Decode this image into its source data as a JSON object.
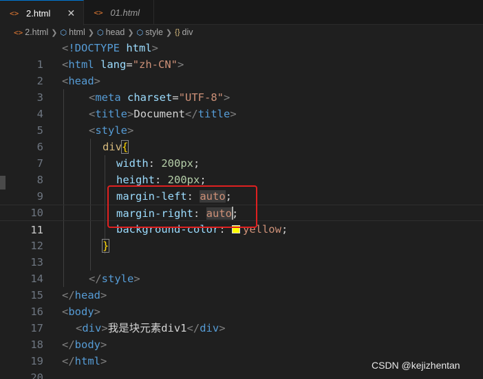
{
  "tabs": [
    {
      "label": "2.html",
      "icon": "html-file-icon",
      "active": true,
      "close": "✕"
    },
    {
      "label": "01.html",
      "icon": "html-file-icon",
      "active": false
    }
  ],
  "breadcrumb": [
    "2.html",
    "html",
    "head",
    "style",
    "div"
  ],
  "lines": [
    {
      "n": "1"
    },
    {
      "n": "2"
    },
    {
      "n": "3"
    },
    {
      "n": "4"
    },
    {
      "n": "5"
    },
    {
      "n": "6"
    },
    {
      "n": "7"
    },
    {
      "n": "8"
    },
    {
      "n": "9"
    },
    {
      "n": "10"
    },
    {
      "n": "11"
    },
    {
      "n": "12"
    },
    {
      "n": "13"
    },
    {
      "n": "14"
    },
    {
      "n": "15"
    },
    {
      "n": "16"
    },
    {
      "n": "17"
    },
    {
      "n": "18"
    },
    {
      "n": "19"
    },
    {
      "n": "20"
    }
  ],
  "code": {
    "doctype": "!DOCTYPE",
    "html": "html",
    "lang_attr": "lang",
    "lang_val": "\"zh-CN\"",
    "head": "head",
    "meta": "meta",
    "charset_attr": "charset",
    "charset_val": "\"UTF-8\"",
    "title": "title",
    "title_text": "Document",
    "style": "style",
    "selector": "div",
    "width_prop": "width",
    "width_val": "200px",
    "height_prop": "height",
    "height_val": "200px",
    "ml_prop": "margin-left",
    "mr_prop": "margin-right",
    "auto1": "auto",
    "auto2_a": "aut",
    "auto2_b": "o",
    "bg_prop": "background-color",
    "bg_val": "yellow",
    "body": "body",
    "div": "div",
    "div_text": "我是块元素div1"
  },
  "watermark": "CSDN @kejizhentan",
  "colors": {
    "highlight_box": "#e02020",
    "swatch": "#ffff00"
  }
}
